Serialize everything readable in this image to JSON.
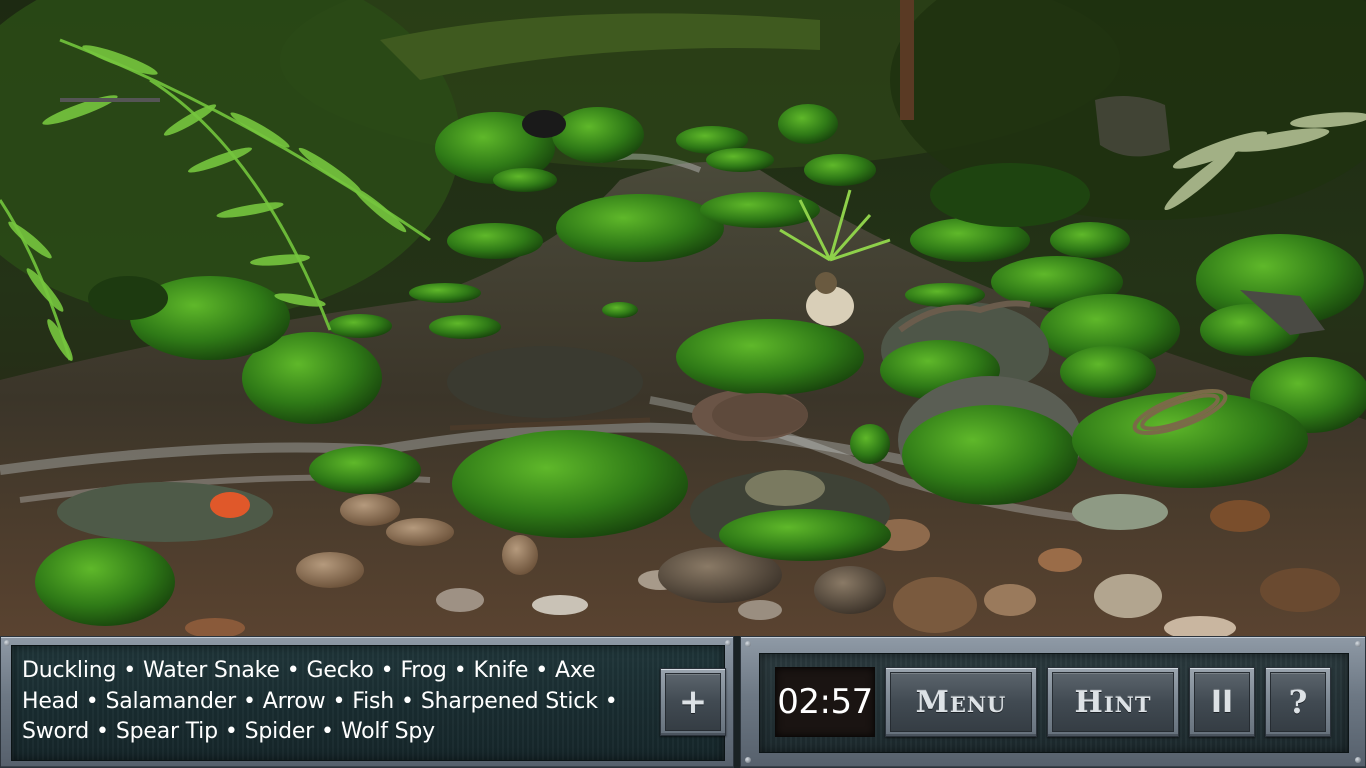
{
  "game": {
    "items_to_find": [
      "Duckling",
      "Water Snake",
      "Gecko",
      "Frog",
      "Knife",
      "Axe Head",
      "Salamander",
      "Arrow",
      "Fish",
      "Sharpened Stick",
      "Sword",
      "Spear Tip",
      "Spider",
      "Wolf Spy"
    ],
    "item_lines": [
      [
        "Duckling",
        "Water Snake",
        "Gecko",
        "Frog",
        "Knife",
        "Axe"
      ],
      [
        "Head",
        "Salamander",
        "Arrow",
        "Fish",
        "Sharpened Stick"
      ],
      [
        "Sword",
        "Spear Tip",
        "Spider",
        "Wolf Spy"
      ]
    ],
    "separator": "•",
    "timer": "02:57",
    "buttons": {
      "expand": "+",
      "menu": "Menu",
      "hint": "Hint",
      "pause": "II",
      "help": "?"
    }
  },
  "icons": {
    "expand": "plus-icon",
    "pause": "pause-icon",
    "help": "question-icon"
  },
  "colors": {
    "panel_metal": "#7d8893",
    "panel_inner": "#1d3034",
    "timer_bg": "#1a1412",
    "text": "#ffffff"
  }
}
